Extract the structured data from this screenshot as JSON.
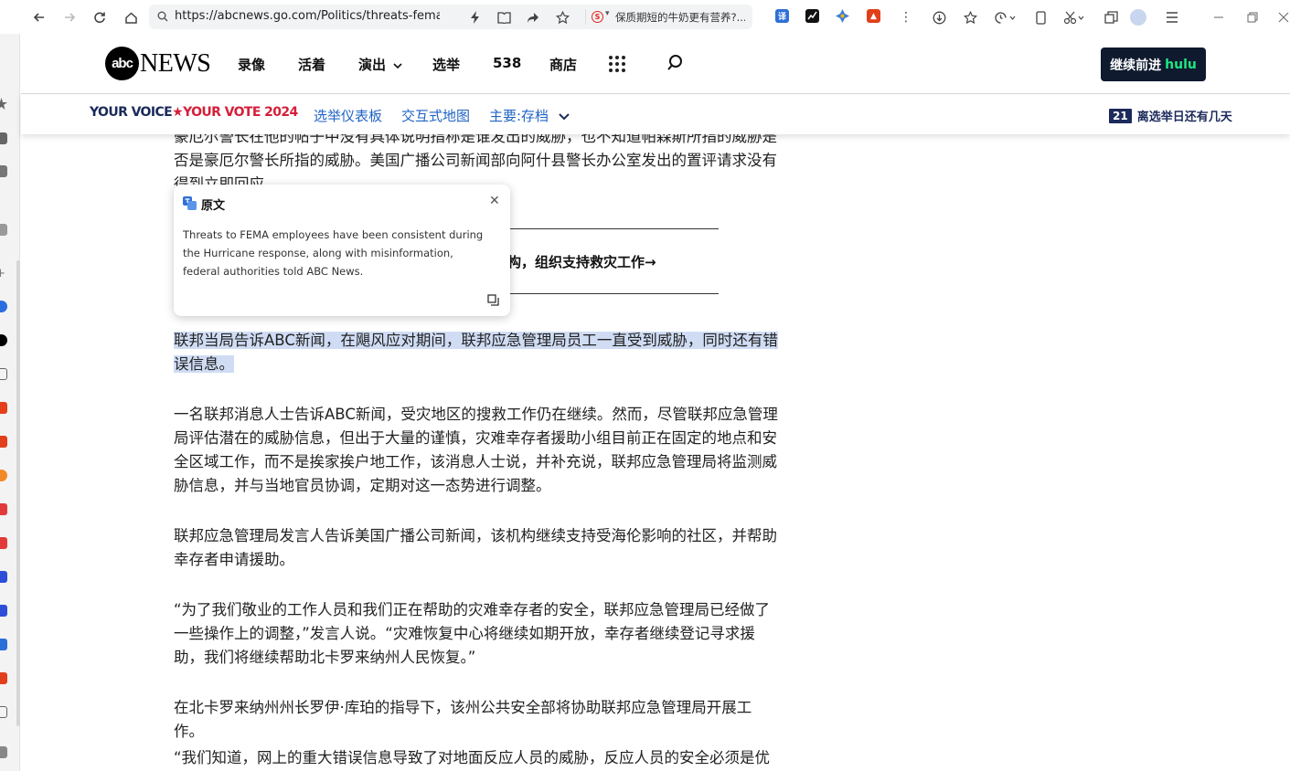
{
  "browser": {
    "url": "https://abcnews.go.com/Politics/threats-fema",
    "suggestion": "保质期短的牛奶更有营养?...",
    "colors": {
      "accent": "#1f63c4"
    }
  },
  "header": {
    "logo_mark": "abc",
    "logo_text": "NEWS",
    "nav": [
      "录像",
      "活着",
      "演出",
      "选举",
      "538",
      "商店"
    ],
    "hulu_button_label": "继续前进",
    "hulu_brand": "hulu"
  },
  "subnav": {
    "brand_part1": "YOUR VOICE",
    "brand_part2": "YOUR VOTE 2024",
    "links": [
      "选举仪表板",
      "交互式地图",
      "主要:存档"
    ],
    "countdown_number": "21",
    "countdown_label": "离选举日还有几天"
  },
  "popup": {
    "title": "原文",
    "body": "Threats to FEMA employees have been consistent during the Hurricane response, along with misinformation, federal authorities told ABC News."
  },
  "article": {
    "top_partial": "豪厄尔警长在他的帖子中没有具体说明指称是谁发出的威胁，也不知道帕森斯所指的威胁是否是豪厄尔警长所指的威胁。美国广播公司新闻部向阿什县警长办公室发出的置评请求没有得到立即回应。",
    "related_link": "构，组织支持救灾工作→",
    "highlighted": "联邦当局告诉ABC新闻，在飓风应对期间，联邦应急管理局员工一直受到威胁，同时还有错误信息。",
    "p2": "一名联邦消息人士告诉ABC新闻，受灾地区的搜救工作仍在继续。然而，尽管联邦应急管理局评估潜在的威胁信息，但出于大量的谨慎，灾难幸存者援助小组目前正在固定的地点和安全区域工作，而不是挨家挨户地工作，该消息人士说，并补充说，联邦应急管理局将监测威胁信息，并与当地官员协调，定期对这一态势进行调整。",
    "p3": "联邦应急管理局发言人告诉美国广播公司新闻，该机构继续支持受海伦影响的社区，并帮助幸存者申请援助。",
    "p4": "“为了我们敬业的工作人员和我们正在帮助的灾难幸存者的安全，联邦应急管理局已经做了一些操作上的调整，”发言人说。“灾难恢复中心将继续如期开放，幸存者继续登记寻求援助，我们将继续帮助北卡罗来纳州人民恢复。”",
    "p5": "在北卡罗来纳州州长罗伊·库珀的指导下，该州公共安全部将协助联邦应急管理局开展工作。",
    "p6": "“我们知道，网上的重大错误信息导致了对地面反应人员的威胁，反应人员的安全必须是优"
  }
}
